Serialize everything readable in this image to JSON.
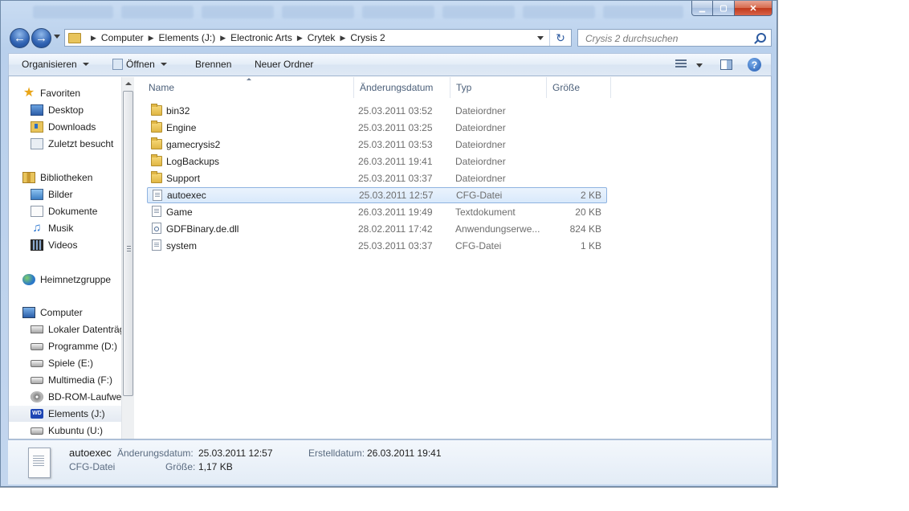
{
  "window": {
    "caption_minimize": "▁",
    "caption_maximize": "▢",
    "caption_close": "✕"
  },
  "address": {
    "crumbs": [
      "Computer",
      "Elements (J:)",
      "Electronic Arts",
      "Crytek",
      "Crysis 2"
    ]
  },
  "search": {
    "placeholder": "Crysis 2 durchsuchen"
  },
  "toolbar": {
    "organize": "Organisieren",
    "open": "Öffnen",
    "burn": "Brennen",
    "new_folder": "Neuer Ordner"
  },
  "nav": {
    "favorites_header": "Favoriten",
    "desktop": "Desktop",
    "downloads": "Downloads",
    "recent": "Zuletzt besucht",
    "libraries_header": "Bibliotheken",
    "pictures": "Bilder",
    "documents": "Dokumente",
    "music": "Musik",
    "videos": "Videos",
    "homegroup": "Heimnetzgruppe",
    "computer_header": "Computer",
    "drive_c": "Lokaler Datenträg",
    "drive_d": "Programme (D:)",
    "drive_e": "Spiele (E:)",
    "drive_f": "Multimedia (F:)",
    "drive_bd": "BD-ROM-Laufwe",
    "drive_j": "Elements (J:)",
    "drive_u": "Kubuntu (U:)",
    "wd_label": "WD"
  },
  "columns": {
    "name": "Name",
    "date": "Änderungsdatum",
    "type": "Typ",
    "size": "Größe"
  },
  "files": [
    {
      "name": "bin32",
      "date": "25.03.2011 03:52",
      "type": "Dateiordner",
      "size": ""
    },
    {
      "name": "Engine",
      "date": "25.03.2011 03:25",
      "type": "Dateiordner",
      "size": ""
    },
    {
      "name": "gamecrysis2",
      "date": "25.03.2011 03:53",
      "type": "Dateiordner",
      "size": ""
    },
    {
      "name": "LogBackups",
      "date": "26.03.2011 19:41",
      "type": "Dateiordner",
      "size": ""
    },
    {
      "name": "Support",
      "date": "25.03.2011 03:37",
      "type": "Dateiordner",
      "size": ""
    },
    {
      "name": "autoexec",
      "date": "25.03.2011 12:57",
      "type": "CFG-Datei",
      "size": "2 KB"
    },
    {
      "name": "Game",
      "date": "26.03.2011 19:49",
      "type": "Textdokument",
      "size": "20 KB"
    },
    {
      "name": "GDFBinary.de.dll",
      "date": "28.02.2011 17:42",
      "type": "Anwendungserwe...",
      "size": "824 KB"
    },
    {
      "name": "system",
      "date": "25.03.2011 03:37",
      "type": "CFG-Datei",
      "size": "1 KB"
    }
  ],
  "details": {
    "name": "autoexec",
    "type": "CFG-Datei",
    "modified_label": "Änderungsdatum:",
    "modified_value": "25.03.2011 12:57",
    "size_label": "Größe:",
    "size_value": "1,17 KB",
    "created_label": "Erstelldatum:",
    "created_value": "26.03.2011 19:41"
  }
}
